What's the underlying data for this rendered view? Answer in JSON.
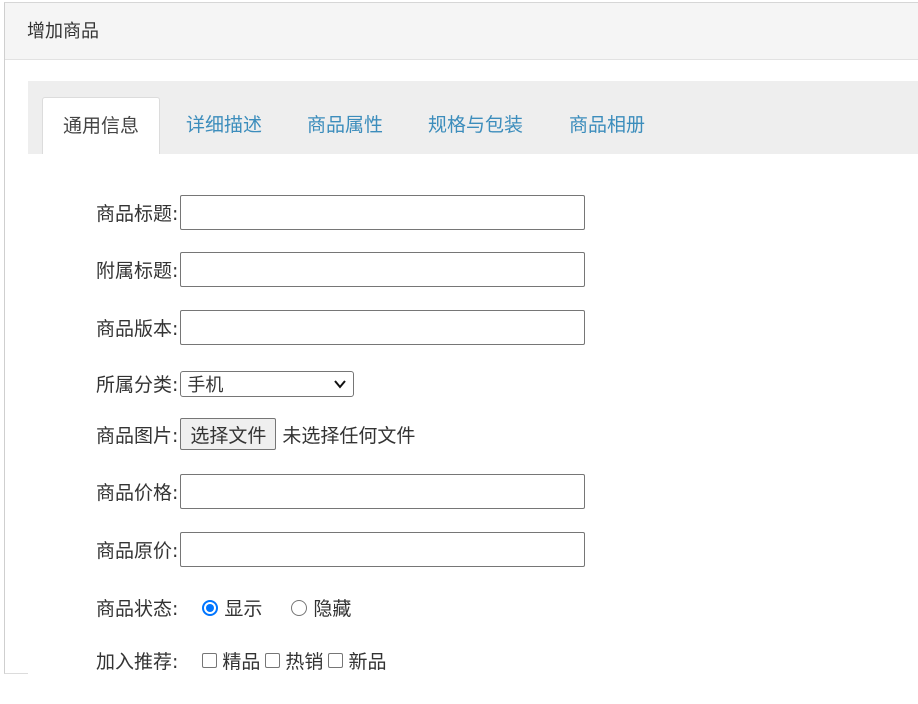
{
  "header": {
    "title": "增加商品"
  },
  "tabs": [
    {
      "label": "通用信息",
      "active": true
    },
    {
      "label": "详细描述",
      "active": false
    },
    {
      "label": "商品属性",
      "active": false
    },
    {
      "label": "规格与包装",
      "active": false
    },
    {
      "label": "商品相册",
      "active": false
    }
  ],
  "form": {
    "title": {
      "label": "商品标题:",
      "value": ""
    },
    "subtitle": {
      "label": "附属标题:",
      "value": ""
    },
    "version": {
      "label": "商品版本:",
      "value": ""
    },
    "category": {
      "label": "所属分类:",
      "selected": "手机"
    },
    "image": {
      "label": "商品图片:",
      "button": "选择文件",
      "status": "未选择任何文件"
    },
    "price": {
      "label": "商品价格:",
      "value": ""
    },
    "original_price": {
      "label": "商品原价:",
      "value": ""
    },
    "status": {
      "label": "商品状态:",
      "options": [
        {
          "label": "显示",
          "checked": true
        },
        {
          "label": "隐藏",
          "checked": false
        }
      ]
    },
    "recommend": {
      "label": "加入推荐:",
      "options": [
        {
          "label": "精品",
          "checked": false
        },
        {
          "label": "热销",
          "checked": false
        },
        {
          "label": "新品",
          "checked": false
        }
      ]
    }
  },
  "colors": {
    "accent": "#3c8dbc",
    "radio": "#0075ff",
    "tab_bar": "#eeeeee",
    "header_bg": "#f5f5f5"
  }
}
